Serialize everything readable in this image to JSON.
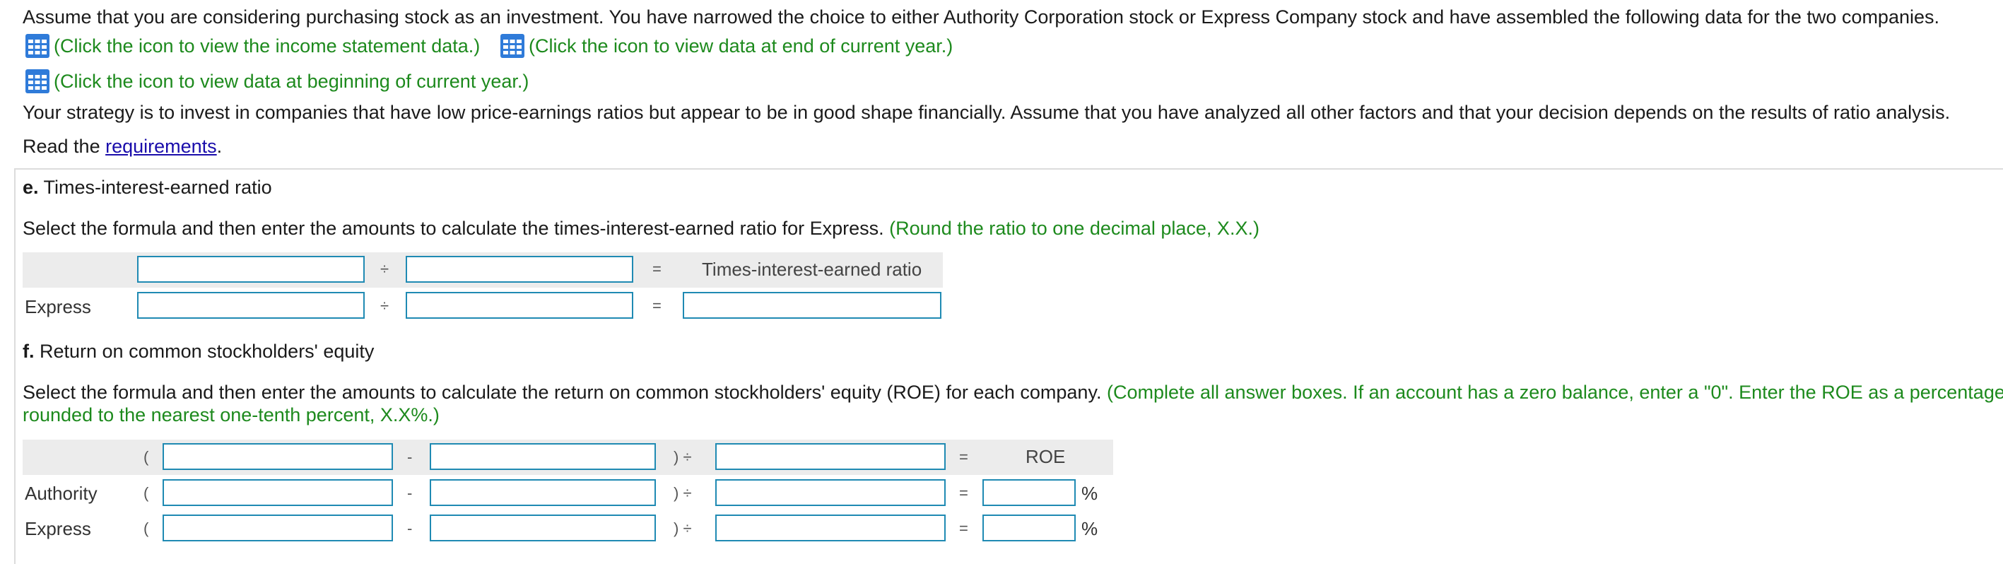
{
  "intro": {
    "line1": "Assume that you are considering purchasing stock as an investment. You have narrowed the choice to either Authority Corporation stock or Express Company stock and have assembled the following data for the two companies.",
    "link_income": "(Click the icon to view the income statement data.)",
    "link_end_year": "(Click the icon to view data at end of current year.)",
    "link_begin_year": "(Click the icon to view data at beginning of current year.)",
    "strategy": "Your strategy is to invest in companies that have low price-earnings ratios but appear to be in good shape financially. Assume that you have analyzed all other factors and that your decision depends on the results of ratio analysis.",
    "read_prefix": "Read the ",
    "read_link": "requirements",
    "read_suffix": "."
  },
  "part_e": {
    "letter": "e.",
    "title": " Times-interest-earned ratio",
    "instruction": "Select the formula and then enter the amounts to calculate the times-interest-earned ratio for Express.",
    "hint": "(Round the ratio to one decimal place, X.X.)",
    "divide": "÷",
    "equals": "=",
    "result_header": "Times-interest-earned ratio",
    "row_label": "Express"
  },
  "part_f": {
    "letter": "f.",
    "title": " Return on common stockholders' equity",
    "instruction": "Select the formula and then enter the amounts to calculate the return on common stockholders' equity (ROE) for each company.",
    "hint_line1": "(Complete all answer boxes. If an account has a zero balance, enter a \"0\". Enter the ROE as a percentage",
    "hint_line2": "rounded to the nearest one-tenth percent, X.X%.)",
    "open_paren": "(",
    "minus": "-",
    "close_divide": ") ÷",
    "equals": "=",
    "result_header": "ROE",
    "percent": "%",
    "rows": [
      "Authority",
      "Express"
    ]
  },
  "colors": {
    "instruction_green": "#1d8a1d",
    "input_border": "#1f8ab3",
    "header_shade": "#ececec",
    "link_blue": "#1a0dab",
    "icon_blue": "#2f7bd9"
  },
  "icons": [
    "table-grid-icon"
  ]
}
